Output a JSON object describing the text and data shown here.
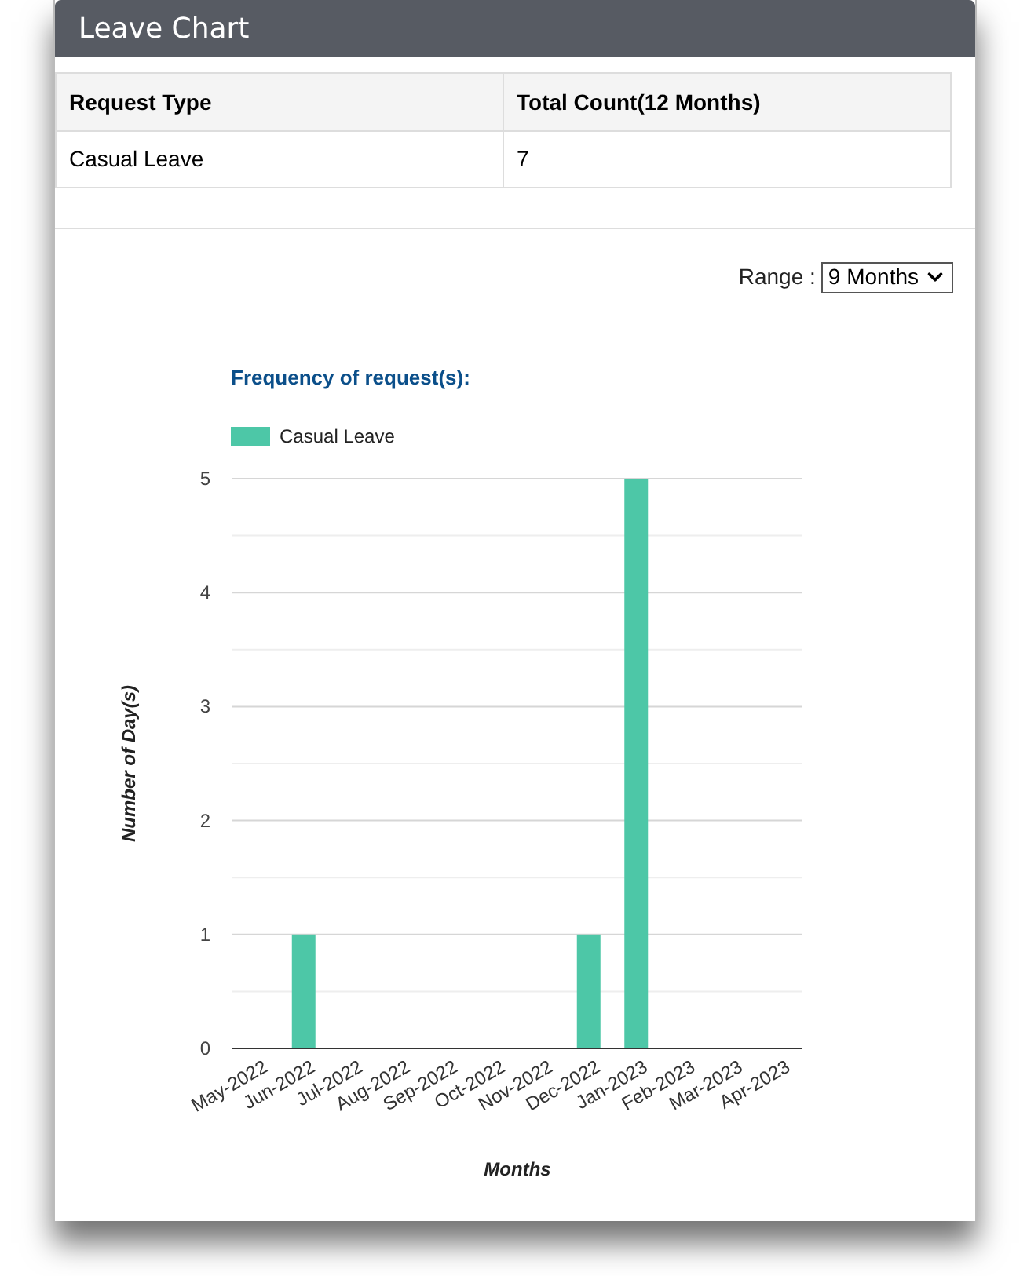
{
  "panel": {
    "title": "Leave Chart"
  },
  "table": {
    "columns": [
      "Request Type",
      "Total Count(12 Months)"
    ],
    "rows": [
      [
        "Casual Leave",
        "7"
      ]
    ]
  },
  "range": {
    "label": "Range :",
    "value": "9 Months"
  },
  "chart": {
    "chart_data": {
      "type": "bar",
      "title": "Frequency of request(s):",
      "xlabel": "Months",
      "ylabel": "Number of Day(s)",
      "categories": [
        "May-2022",
        "Jun-2022",
        "Jul-2022",
        "Aug-2022",
        "Sep-2022",
        "Oct-2022",
        "Nov-2022",
        "Dec-2022",
        "Jan-2023",
        "Feb-2023",
        "Mar-2023",
        "Apr-2023"
      ],
      "series": [
        {
          "name": "Casual Leave",
          "color": "#4dc7a7",
          "values": [
            0,
            1,
            0,
            0,
            0,
            0,
            0,
            1,
            5,
            0,
            0,
            0
          ]
        }
      ],
      "ylim": [
        0,
        5
      ],
      "grid": true,
      "yticks": [
        0,
        1,
        2,
        3,
        4,
        5
      ]
    }
  }
}
